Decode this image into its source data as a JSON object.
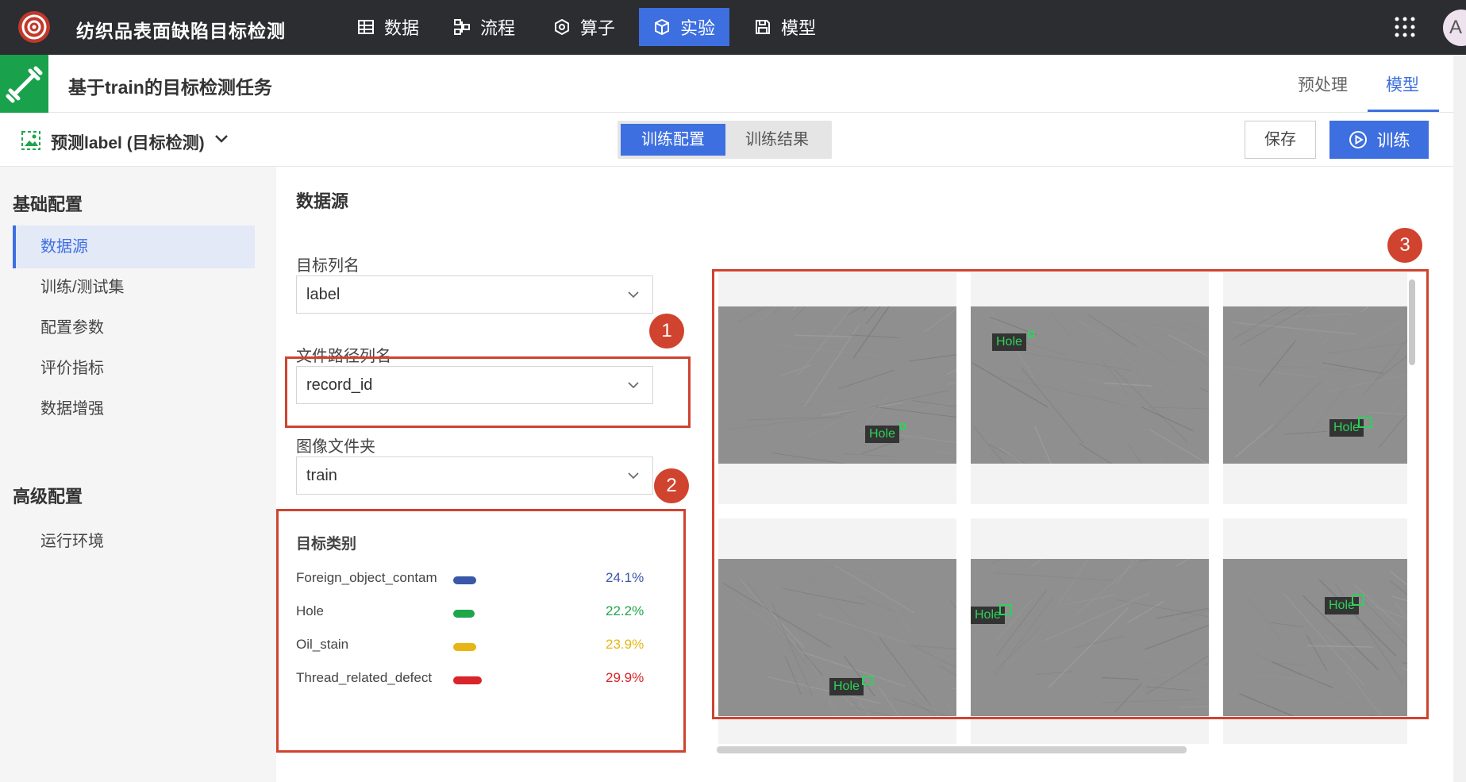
{
  "app": {
    "title": "纺织品表面缺陷目标检测",
    "avatar_initial": "A"
  },
  "nav": [
    {
      "label": "数据",
      "icon": "table-icon"
    },
    {
      "label": "流程",
      "icon": "flow-icon"
    },
    {
      "label": "算子",
      "icon": "hexagon-icon"
    },
    {
      "label": "实验",
      "icon": "cube-icon",
      "active": true
    },
    {
      "label": "模型",
      "icon": "floppy-icon"
    }
  ],
  "task": {
    "title": "基于train的目标检测任务",
    "tabs": [
      {
        "label": "预处理"
      },
      {
        "label": "模型",
        "active": true
      }
    ]
  },
  "toolbar": {
    "prediction_label": "预测label (目标检测)",
    "segments": [
      {
        "label": "训练配置",
        "active": true
      },
      {
        "label": "训练结果"
      }
    ],
    "save_label": "保存",
    "train_label": "训练"
  },
  "sidebar": {
    "basic_group": "基础配置",
    "basic_items": [
      {
        "label": "数据源",
        "active": true
      },
      {
        "label": "训练/测试集"
      },
      {
        "label": "配置参数"
      },
      {
        "label": "评价指标"
      },
      {
        "label": "数据增强"
      }
    ],
    "advanced_group": "高级配置",
    "advanced_items": [
      {
        "label": "运行环境"
      }
    ]
  },
  "main": {
    "section_title": "数据源",
    "target_column": {
      "label": "目标列名",
      "value": "label"
    },
    "path_column": {
      "label": "文件路径列名",
      "value": "record_id"
    },
    "image_folder": {
      "label": "图像文件夹",
      "value": "train"
    },
    "classes_title": "目标类别",
    "classes": [
      {
        "name": "Foreign_object_contam",
        "pct": "24.1%",
        "share": 0.241,
        "color": "#3a58a8"
      },
      {
        "name": "Hole",
        "pct": "22.2%",
        "share": 0.222,
        "color": "#1fa64b"
      },
      {
        "name": "Oil_stain",
        "pct": "23.9%",
        "share": 0.239,
        "color": "#e7b514"
      },
      {
        "name": "Thread_related_defect",
        "pct": "29.9%",
        "share": 0.299,
        "color": "#d8242a"
      }
    ]
  },
  "annotations": {
    "badge1": "1",
    "badge2": "2",
    "badge3": "3"
  },
  "gallery": {
    "tag": "Hole"
  },
  "colors": {
    "accent": "#3d6fe0",
    "annotation_red": "#d0432f",
    "bbox_green": "#2fd15a"
  }
}
